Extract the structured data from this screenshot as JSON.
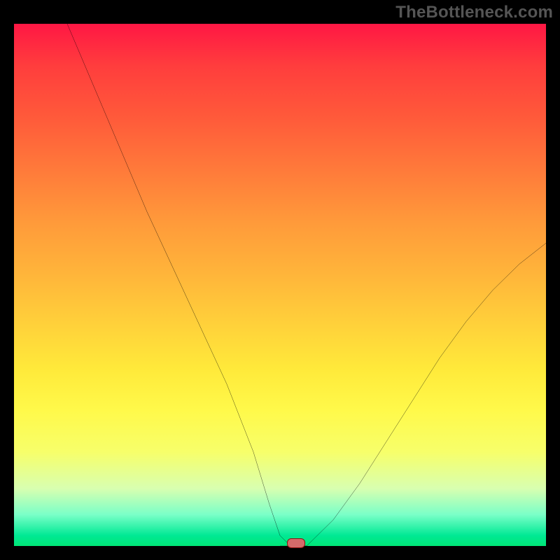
{
  "watermark": "TheBottleneck.com",
  "chart_data": {
    "type": "line",
    "title": "",
    "xlabel": "",
    "ylabel": "",
    "xlim": [
      0,
      100
    ],
    "ylim": [
      0,
      100
    ],
    "grid": false,
    "series": [
      {
        "name": "curve",
        "x": [
          10,
          15,
          20,
          25,
          30,
          35,
          40,
          45,
          48,
          50,
          52,
          55,
          60,
          65,
          70,
          75,
          80,
          85,
          90,
          95,
          100
        ],
        "y": [
          100,
          88,
          76,
          64,
          53,
          42,
          31,
          18,
          8,
          2,
          0,
          0,
          5,
          12,
          20,
          28,
          36,
          43,
          49,
          54,
          58
        ]
      }
    ],
    "marker": {
      "x": 53,
      "y": 0.5,
      "color": "#d46a6a"
    },
    "background_gradient": {
      "orientation": "vertical",
      "stops": [
        {
          "pos": 0.0,
          "color": "#ff1744"
        },
        {
          "pos": 0.4,
          "color": "#ff9a3a"
        },
        {
          "pos": 0.7,
          "color": "#ffe93a"
        },
        {
          "pos": 0.9,
          "color": "#d8ffb0"
        },
        {
          "pos": 1.0,
          "color": "#00e676"
        }
      ]
    }
  }
}
